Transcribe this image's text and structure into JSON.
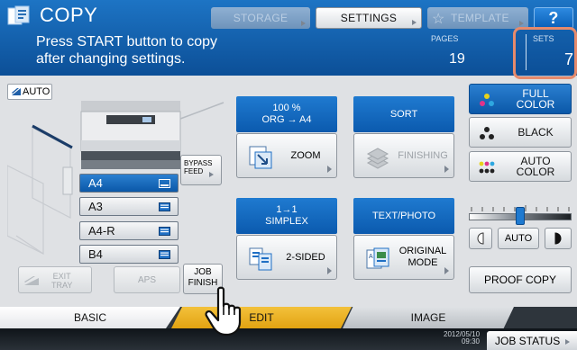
{
  "header": {
    "mode_title": "COPY",
    "storage_label": "STORAGE",
    "settings_label": "SETTINGS",
    "template_label": "TEMPLATE",
    "help_label": "?",
    "message_line1": "Press START button to copy",
    "message_line2": "after changing settings.",
    "pages_label": "PAGES",
    "pages_value": "19",
    "sets_label": "SETS",
    "sets_value": "7"
  },
  "paper": {
    "auto_label": "AUTO",
    "bypass_label_line1": "BYPASS",
    "bypass_label_line2": "FEED",
    "trays": [
      {
        "label": "A4",
        "selected": true
      },
      {
        "label": "A3",
        "selected": false
      },
      {
        "label": "A4-R",
        "selected": false
      },
      {
        "label": "B4",
        "selected": false
      }
    ],
    "exit_tray_line1": "EXIT",
    "exit_tray_line2": "TRAY",
    "aps_label": "APS",
    "job_finish_line1": "JOB",
    "job_finish_line2": "FINISH"
  },
  "functions": {
    "zoom_info_line1": "100 %",
    "zoom_info_line2": "ORG  →  A4",
    "zoom_label": "ZOOM",
    "sort_info": "SORT",
    "finishing_label": "FINISHING",
    "duplex_info_line1": "1→1",
    "duplex_info_line2": "SIMPLEX",
    "two_sided_label": "2-SIDED",
    "original_info": "TEXT/PHOTO",
    "original_mode_line1": "ORIGINAL",
    "original_mode_line2": "MODE"
  },
  "color": {
    "full_color_line1": "FULL",
    "full_color_line2": "COLOR",
    "black_label": "BLACK",
    "auto_color_line1": "AUTO",
    "auto_color_line2": "COLOR",
    "density_auto_label": "AUTO",
    "density_level": 0.5
  },
  "proof_copy_label": "PROOF COPY",
  "tabs": {
    "basic": "BASIC",
    "edit": "EDIT",
    "image": "IMAGE"
  },
  "status": {
    "date": "2012/05/10",
    "time": "09:30",
    "job_status_label": "JOB STATUS"
  },
  "colors": {
    "header_blue": "#0c4f97",
    "accent_blue": "#1f7ad0",
    "sets_highlight": "#e68a6c",
    "edit_tab": "#e2a312"
  }
}
